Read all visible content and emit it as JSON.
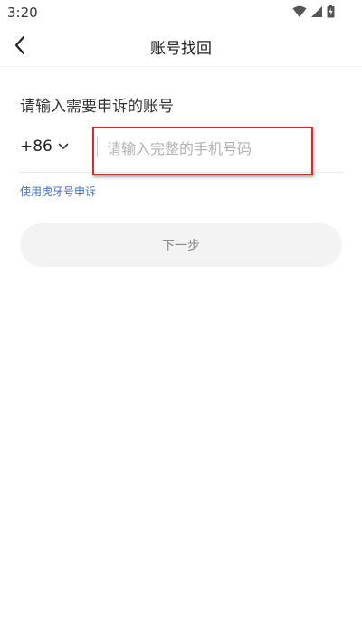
{
  "status_bar": {
    "time": "3:20",
    "icons": [
      "wifi-icon",
      "signal-icon",
      "battery-icon"
    ]
  },
  "nav": {
    "title": "账号找回",
    "back_icon": "chevron-left-icon"
  },
  "form": {
    "heading": "请输入需要申诉的账号",
    "country_code": "+86",
    "country_code_icon": "chevron-down-icon",
    "phone_value": "",
    "phone_placeholder": "请输入完整的手机号码",
    "alt_link": "使用虎牙号申诉",
    "next_label": "下一步"
  },
  "colors": {
    "link": "#3b6fd4",
    "highlight_border": "#e0262b",
    "button_bg": "#f3f3f3",
    "button_text": "#888888"
  }
}
